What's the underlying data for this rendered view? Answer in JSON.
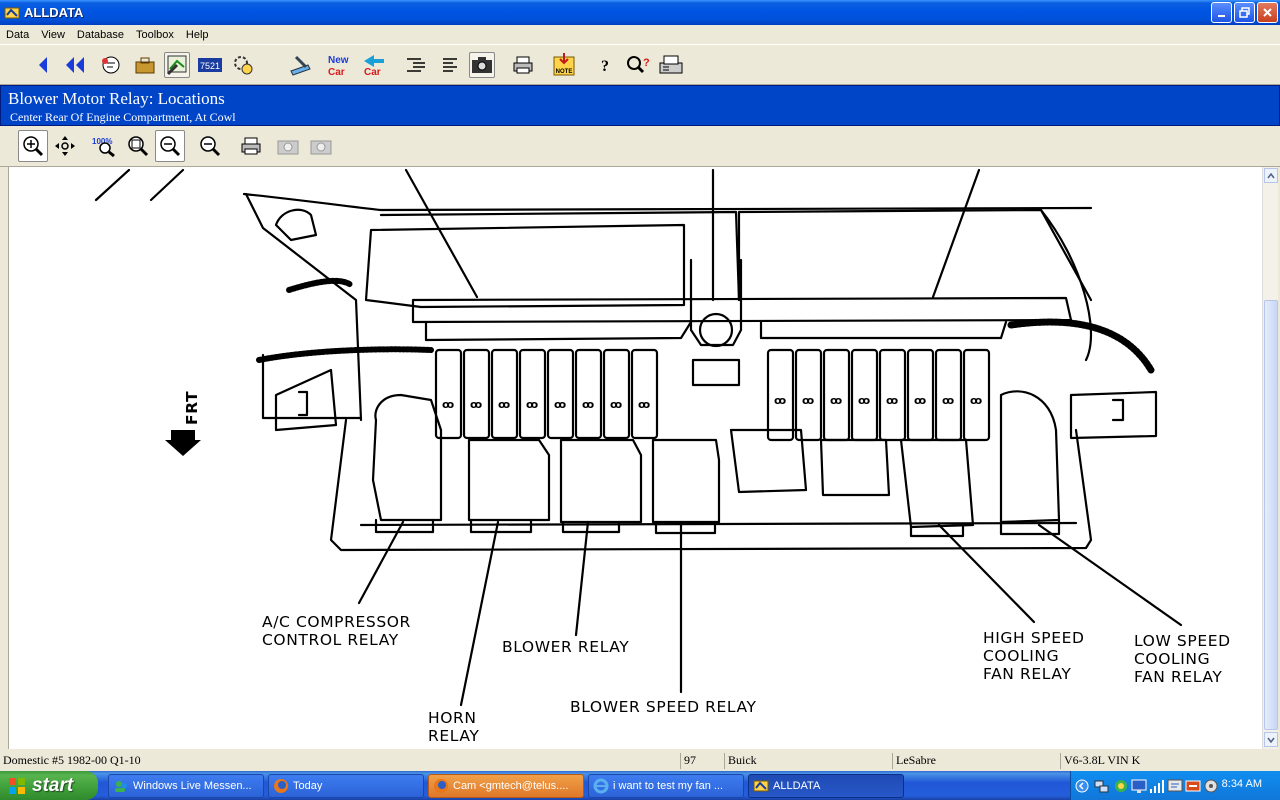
{
  "window": {
    "title": "ALLDATA"
  },
  "menu": {
    "items": [
      "Data",
      "View",
      "Database",
      "Toolbox",
      "Help"
    ]
  },
  "toolbar": {
    "vehicle_label": "7521",
    "new_car_label": "New Car",
    "car_label": "Car",
    "note_label": "NOTE",
    "help_label": "?"
  },
  "header": {
    "title": "Blower Motor Relay:  Locations",
    "subtitle": "Center Rear Of Engine Compartment, At Cowl"
  },
  "image_toolbar": {
    "zoom_label": "100%"
  },
  "diagram": {
    "front_label": "FRT",
    "labels": {
      "ac_line1": "A/C COMPRESSOR",
      "ac_line2": "CONTROL RELAY",
      "horn_line1": "HORN",
      "horn_line2": "RELAY",
      "blower": "BLOWER RELAY",
      "blower_speed": "BLOWER SPEED RELAY",
      "high_line1": "HIGH SPEED",
      "high_line2": "COOLING",
      "high_line3": "FAN RELAY",
      "low_line1": "LOW SPEED",
      "low_line2": "COOLING",
      "low_line3": "FAN RELAY"
    }
  },
  "status": {
    "database": "Domestic #5 1982-00 Q1-10",
    "year": "97",
    "make": "Buick",
    "model": "LeSabre",
    "engine": "V6-3.8L VIN K"
  },
  "taskbar": {
    "start_label": "start",
    "tasks": [
      {
        "label": "Windows Live Messen..."
      },
      {
        "label": "Today"
      },
      {
        "label": "Cam <gmtech@telus...."
      },
      {
        "label": "i want to test my fan ..."
      },
      {
        "label": "ALLDATA"
      }
    ],
    "clock": "8:34 AM"
  },
  "colors": {
    "title_blue": "#0054e3",
    "header_blue": "#0044c8",
    "start_green": "#3f9e39"
  }
}
